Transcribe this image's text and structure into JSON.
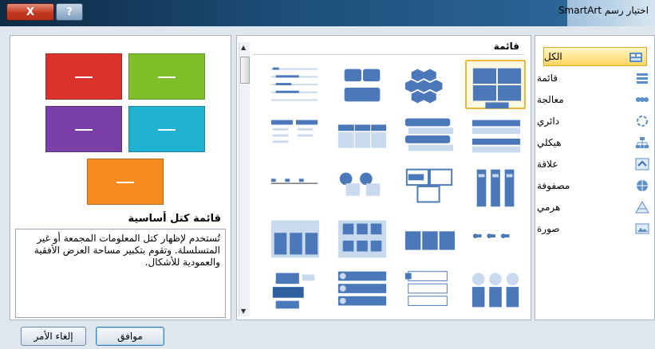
{
  "window": {
    "title": "اختيار رسم SmartArt",
    "close_label": "X",
    "help_label": "?"
  },
  "categories": [
    {
      "label": "الكل",
      "icon": "all-icon",
      "selected": true
    },
    {
      "label": "قائمة",
      "icon": "list-icon"
    },
    {
      "label": "معالجة",
      "icon": "process-icon"
    },
    {
      "label": "دائري",
      "icon": "cycle-icon"
    },
    {
      "label": "هيكلي",
      "icon": "hierarchy-icon"
    },
    {
      "label": "علاقة",
      "icon": "relationship-icon"
    },
    {
      "label": "مصفوفة",
      "icon": "matrix-icon"
    },
    {
      "label": "هرمي",
      "icon": "pyramid-icon"
    },
    {
      "label": "صورة",
      "icon": "picture-icon"
    }
  ],
  "gallery": {
    "header": "قائمة"
  },
  "preview": {
    "title": "قائمة كتل أساسية",
    "description": "تُستخدم لإظهار كتل المعلومات المجمعة أو غير المتسلسلة. وتقوم بتكبير مساحة العرض الأفقية والعمودية للأشكال.",
    "colors": [
      "#d9332b",
      "#7fbf2a",
      "#7b3fa8",
      "#1fb2d2",
      "#f68c1f"
    ]
  },
  "buttons": {
    "ok": "موافق",
    "cancel": "إلغاء الأمر"
  }
}
